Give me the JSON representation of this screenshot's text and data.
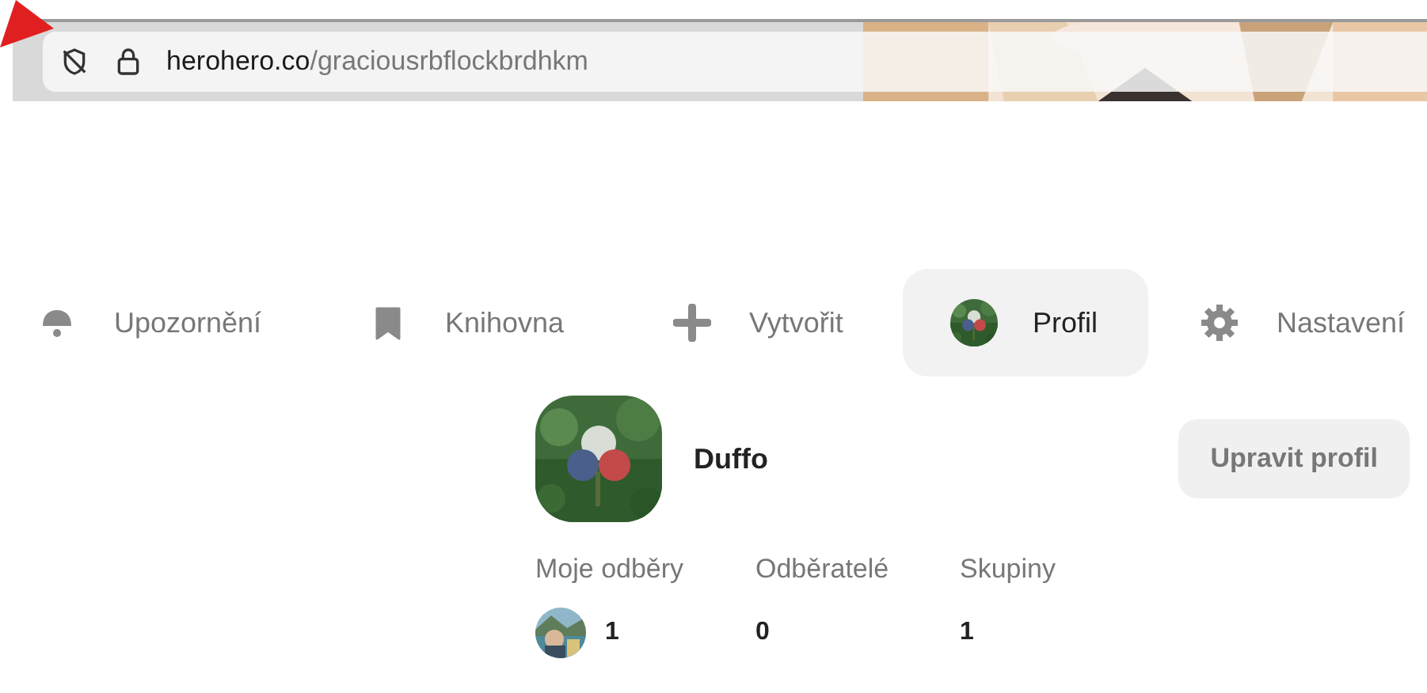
{
  "address_bar": {
    "host": "herohero.co",
    "path": "/graciousrbflockbrdhkm"
  },
  "nav": [
    {
      "kind": "notifications",
      "label": "Upozornění",
      "selected": false
    },
    {
      "kind": "library",
      "label": "Knihovna",
      "selected": false
    },
    {
      "kind": "create",
      "label": "Vytvořit",
      "selected": false
    },
    {
      "kind": "profile",
      "label": "Profil",
      "selected": true
    },
    {
      "kind": "settings",
      "label": "Nastavení",
      "selected": false
    }
  ],
  "profile": {
    "name": "Duffo",
    "edit_button": "Upravit profil",
    "stats": [
      {
        "label": "Moje odběry",
        "value": "1"
      },
      {
        "label": "Odběratelé",
        "value": "0"
      },
      {
        "label": "Skupiny",
        "value": "1"
      }
    ]
  }
}
